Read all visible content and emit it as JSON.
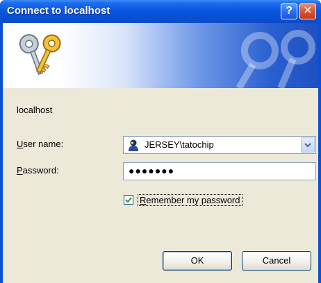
{
  "dialog": {
    "title": "Connect to localhost",
    "help_glyph": "?",
    "close_glyph": "✕"
  },
  "banner": {
    "icon": "keys-icon"
  },
  "form": {
    "server": "localhost",
    "username_label": "User name:",
    "username_value": "JERSEY\\tatochip",
    "password_label": "Password:",
    "password_value": "●●●●●●●",
    "remember_label": "Remember my password",
    "remember_checked": true
  },
  "buttons": {
    "ok": "OK",
    "cancel": "Cancel"
  },
  "colors": {
    "titlebar": "#0a58e0",
    "client": "#ece9d8",
    "field_border": "#7f9db9"
  }
}
